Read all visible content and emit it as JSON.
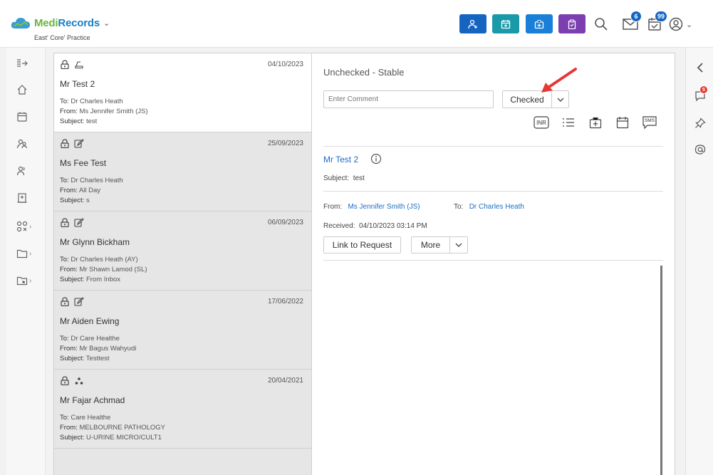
{
  "app": {
    "brand_medi": "Medi",
    "brand_records": "Records",
    "practice": "East' Core' Practice"
  },
  "header": {
    "buttons": [
      {
        "name": "add-patient-icon",
        "color": "#1565c0"
      },
      {
        "name": "appointment-icon",
        "color": "#1a9aa8"
      },
      {
        "name": "medical-kit-icon",
        "color": "#1a7fd6"
      },
      {
        "name": "clipboard-icon",
        "color": "#7b3fb0"
      }
    ],
    "mail_badge": "6",
    "tasks_badge": "99"
  },
  "messages": [
    {
      "icons": [
        "lock-icon",
        "scanner-icon"
      ],
      "date": "04/10/2023",
      "name": "Mr Test 2",
      "to_label": "To:",
      "to": "Dr Charles Heath",
      "from_label": "From:",
      "from": "Ms Jennifer Smith (JS)",
      "subject_label": "Subject:",
      "subject": "test",
      "active": true
    },
    {
      "icons": [
        "lock-icon",
        "edit-icon"
      ],
      "date": "25/09/2023",
      "name": "Ms Fee Test",
      "to_label": "To:",
      "to": "Dr Charles Heath",
      "from_label": "From:",
      "from": "All Day",
      "subject_label": "Subject:",
      "subject": "s",
      "active": false
    },
    {
      "icons": [
        "lock-icon",
        "edit-icon"
      ],
      "date": "06/09/2023",
      "name": "Mr Glynn Bickham",
      "to_label": "To:",
      "to": "Dr Charles Heath (AY)",
      "from_label": "From:",
      "from": "Mr Shawn Lamod (SL)",
      "subject_label": "Subject:",
      "subject": "From Inbox",
      "active": false
    },
    {
      "icons": [
        "lock-icon",
        "edit-icon"
      ],
      "date": "17/06/2022",
      "name": "Mr Aiden Ewing",
      "to_label": "To:",
      "to": "Dr Care Healthe",
      "from_label": "From:",
      "from": "Mr Bagus Wahyudi",
      "subject_label": "Subject:",
      "subject": "Testtest",
      "active": false
    },
    {
      "icons": [
        "lock-icon",
        "hierarchy-icon"
      ],
      "date": "20/04/2021",
      "name": "Mr Fajar Achmad",
      "to_label": "To:",
      "to": "Care Healthe",
      "from_label": "From:",
      "from": "MELBOURNE PATHOLOGY",
      "subject_label": "Subject:",
      "subject": "U-URINE MICRO/CULT1",
      "active": false
    }
  ],
  "detail": {
    "status_title": "Unchecked - Stable",
    "comment_placeholder": "Enter Comment",
    "checked_label": "Checked",
    "tools": {
      "inr": "INR",
      "sms": "SMS"
    },
    "patient": "Mr Test 2",
    "subject_label": "Subject:",
    "subject": "test",
    "from_label": "From:",
    "from": "Ms Jennifer Smith (JS)",
    "to_label": "To:",
    "to": "Dr Charles Heath",
    "received_label": "Received:",
    "received": "04/10/2023 03:14 PM",
    "link_btn": "Link to Request",
    "more_btn": "More"
  },
  "right_rail": {
    "chat_badge": "5"
  }
}
